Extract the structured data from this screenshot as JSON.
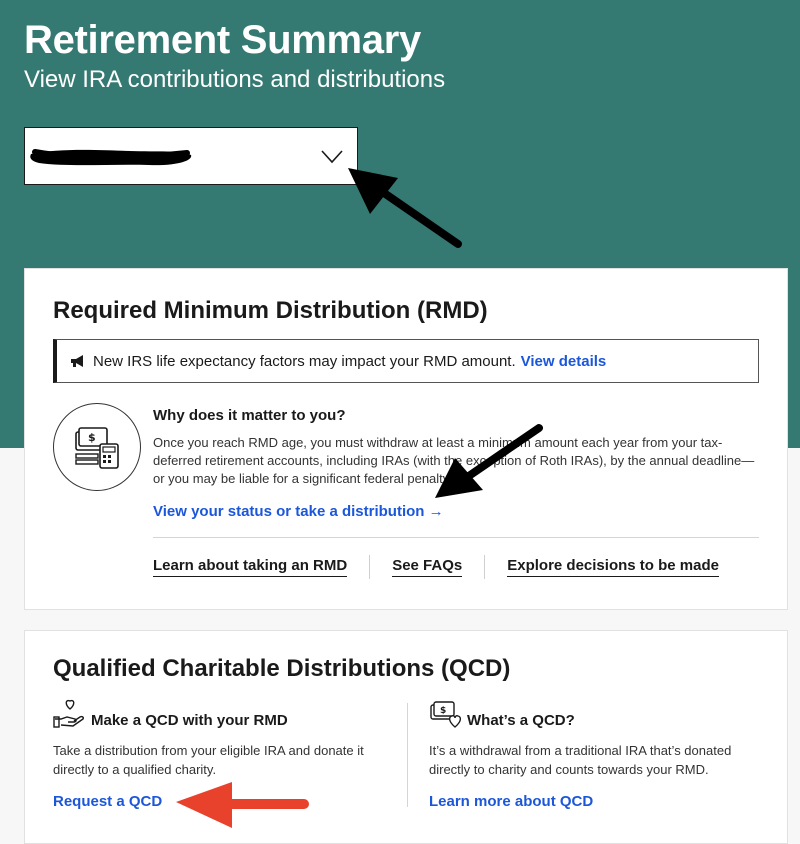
{
  "header": {
    "title": "Retirement Summary",
    "subtitle": "View IRA contributions and distributions",
    "account_select": {
      "value": "",
      "redacted": true
    }
  },
  "rmd": {
    "title": "Required Minimum Distribution (RMD)",
    "notice": {
      "icon": "megaphone-icon",
      "text": "New IRS life expectancy factors may impact your RMD amount.",
      "link": "View details"
    },
    "why_heading": "Why does it matter to you?",
    "why_body": "Once you reach RMD age, you must withdraw at least a minimum amount each year from your tax-deferred retirement accounts, including IRAs (with the exception of Roth IRAs), by the annual deadline—or you may be liable for a significant federal penalty.",
    "status_link": "View your status or take a distribution",
    "bottom_links": [
      "Learn about taking an RMD",
      "See FAQs",
      "Explore decisions to be made"
    ]
  },
  "qcd": {
    "title": "Qualified Charitable Distributions (QCD)",
    "left": {
      "icon": "hand-heart-icon",
      "heading": "Make a QCD with your RMD",
      "text": "Take a distribution from your eligible IRA and donate it directly to a qualified charity.",
      "link": "Request a QCD"
    },
    "right": {
      "icon": "money-heart-icon",
      "heading": "What’s a QCD?",
      "text": "It’s a withdrawal from a traditional IRA that’s donated directly to charity and counts towards your RMD.",
      "link": "Learn more about QCD"
    }
  },
  "colors": {
    "hero_bg": "#347a72",
    "link_blue": "#1c57d9",
    "annotation_red": "#e8412c",
    "annotation_black": "#000000"
  }
}
